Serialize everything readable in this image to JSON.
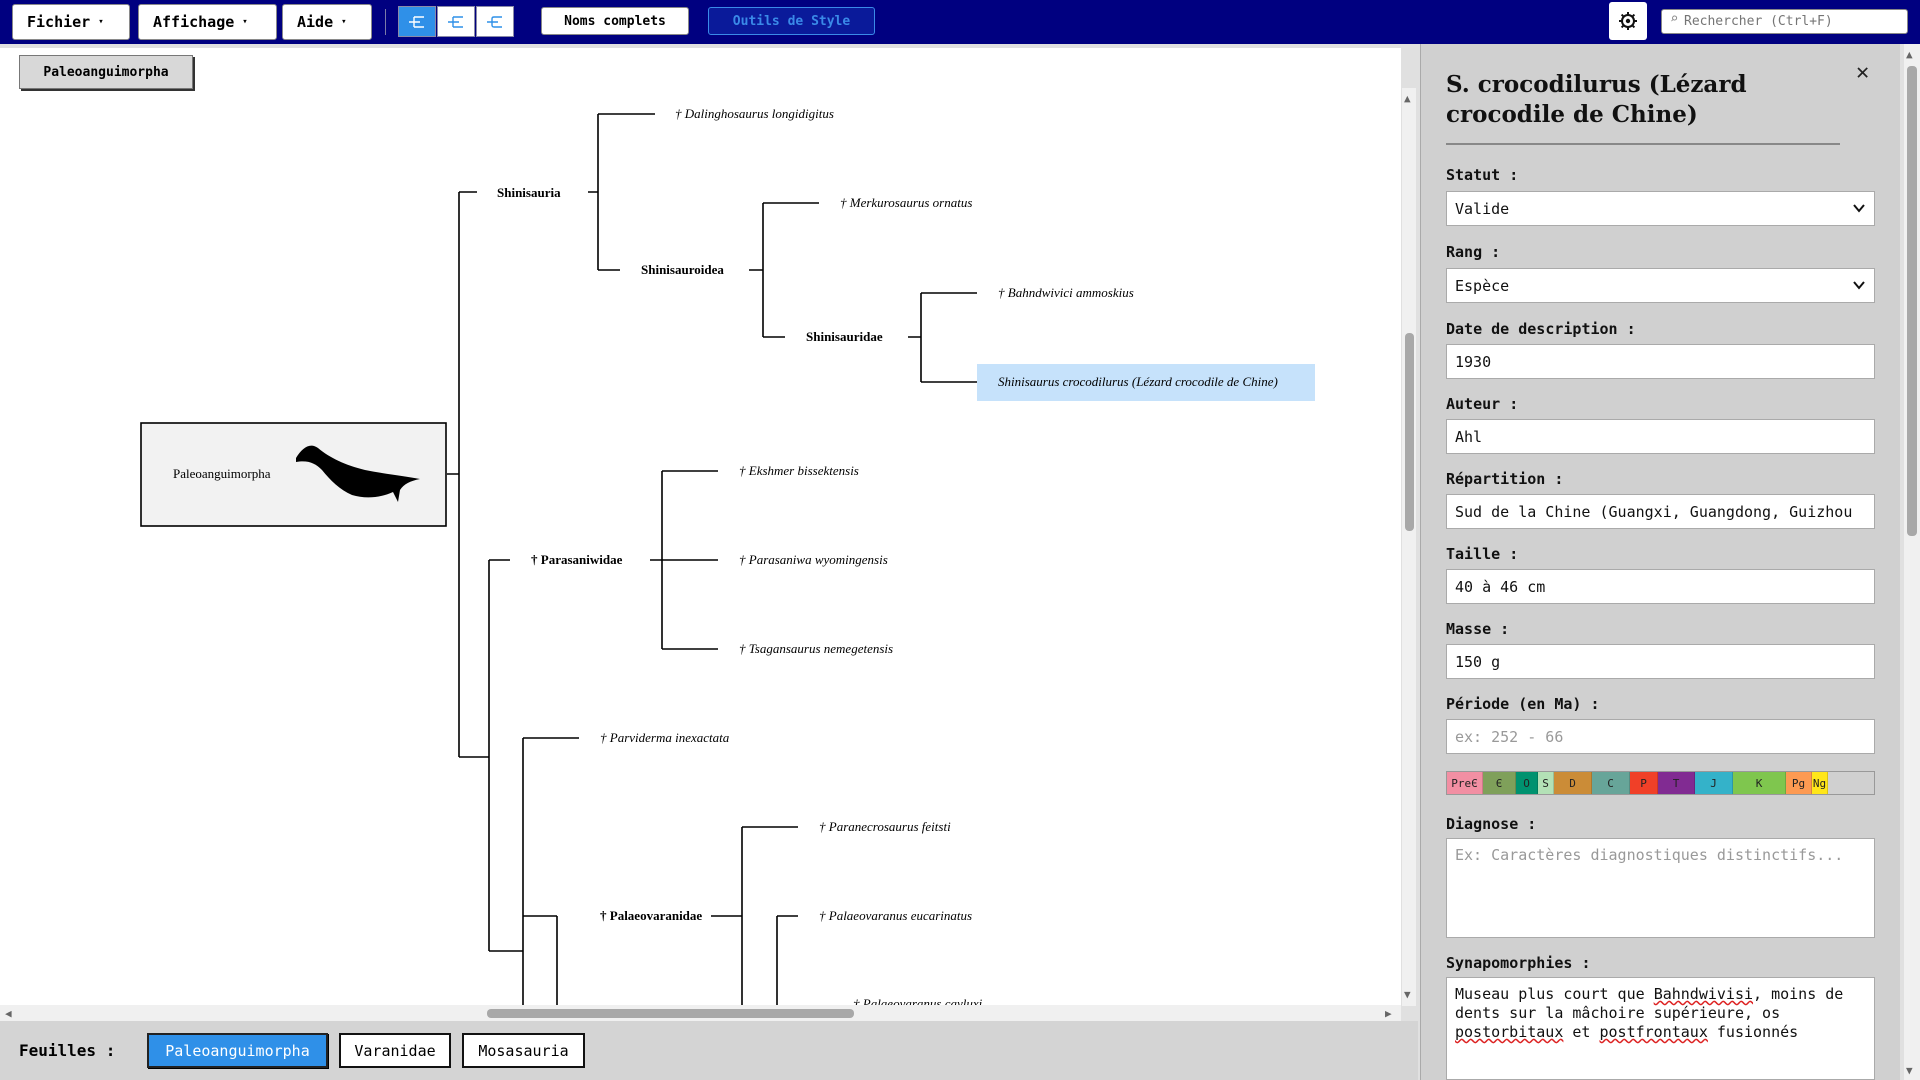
{
  "menu": {
    "file": "Fichier",
    "view": "Affichage",
    "help": "Aide",
    "arrow": "▾",
    "full_names": "Noms complets",
    "style_tools": "Outils de Style",
    "search_placeholder": "Rechercher (Ctrl+F)"
  },
  "canvas": {
    "root_chip": "Paleoanguimorpha",
    "root_box_label": "Paleoanguimorpha"
  },
  "tree": {
    "clades": {
      "shinisauria": "Shinisauria",
      "shinisauroidea": "Shinisauroidea",
      "shinisauridae": "Shinisauridae",
      "parasaniwidae": "† Parasaniwidae",
      "palaeovaranidae": "† Palaeovaranidae"
    },
    "leaves": {
      "dalinghosaurus": "† Dalinghosaurus longidigitus",
      "merkurosaurus": "† Merkurosaurus ornatus",
      "bahndwivici": "† Bahndwivici ammoskius",
      "shinisaurus": "Shinisaurus crocodilurus (Lézard crocodile de Chine)",
      "ekshmer": "† Ekshmer bissektensis",
      "parasaniwa": "† Parasaniwa wyomingensis",
      "tsagansaurus": "† Tsagansaurus nemegetensis",
      "parviderma": "† Parviderma inexactata",
      "paranecrosaurus": "† Paranecrosaurus feitsti",
      "palaeovaranus_e": "† Palaeovaranus eucarinatus",
      "palaeovaranus_c": "† Palaeovaranus cayluxi"
    },
    "selected_color": "#c6e2fb"
  },
  "tabs": {
    "label": "Feuilles :",
    "items": [
      "Paleoanguimorpha",
      "Varanidae",
      "Mosasauria"
    ],
    "active_index": 0
  },
  "panel": {
    "title": "S. crocodilurus (Lézard crocodile de Chine)",
    "status_label": "Statut :",
    "status_value": "Valide",
    "rank_label": "Rang :",
    "rank_value": "Espèce",
    "date_label": "Date de description :",
    "date_value": "1930",
    "author_label": "Auteur :",
    "author_value": "Ahl",
    "distribution_label": "Répartition :",
    "distribution_value": "Sud de la Chine (Guangxi, Guangdong, Guizhou",
    "size_label": "Taille :",
    "size_value": "40 à 46 cm",
    "mass_label": "Masse :",
    "mass_value": "150 g",
    "period_label": "Période (en Ma) :",
    "period_placeholder": "ex: 252 - 66",
    "periods": [
      {
        "label": "PreЄ",
        "color": "#f28fa3"
      },
      {
        "label": "Є",
        "color": "#7fa05a"
      },
      {
        "label": "O",
        "color": "#00926f"
      },
      {
        "label": "S",
        "color": "#b3e1b6"
      },
      {
        "label": "D",
        "color": "#cb8c37"
      },
      {
        "label": "C",
        "color": "#67a599"
      },
      {
        "label": "P",
        "color": "#f04028"
      },
      {
        "label": "T",
        "color": "#812b92"
      },
      {
        "label": "J",
        "color": "#34b2c9"
      },
      {
        "label": "K",
        "color": "#7fc64e"
      },
      {
        "label": "Pg",
        "color": "#fd9a52"
      },
      {
        "label": "Ng",
        "color": "#ffe619"
      }
    ],
    "diagnosis_label": "Diagnose :",
    "diagnosis_placeholder": "Ex: Caractères diagnostiques distinctifs...",
    "synapo_label": "Synapomorphies :",
    "synapo_parts": [
      "Museau plus court que ",
      "Bahndwivisi",
      ", moins de dents sur la mâchoire supérieure, os ",
      "postorbitaux",
      " et ",
      "postfrontaux",
      " fusionnés"
    ]
  }
}
